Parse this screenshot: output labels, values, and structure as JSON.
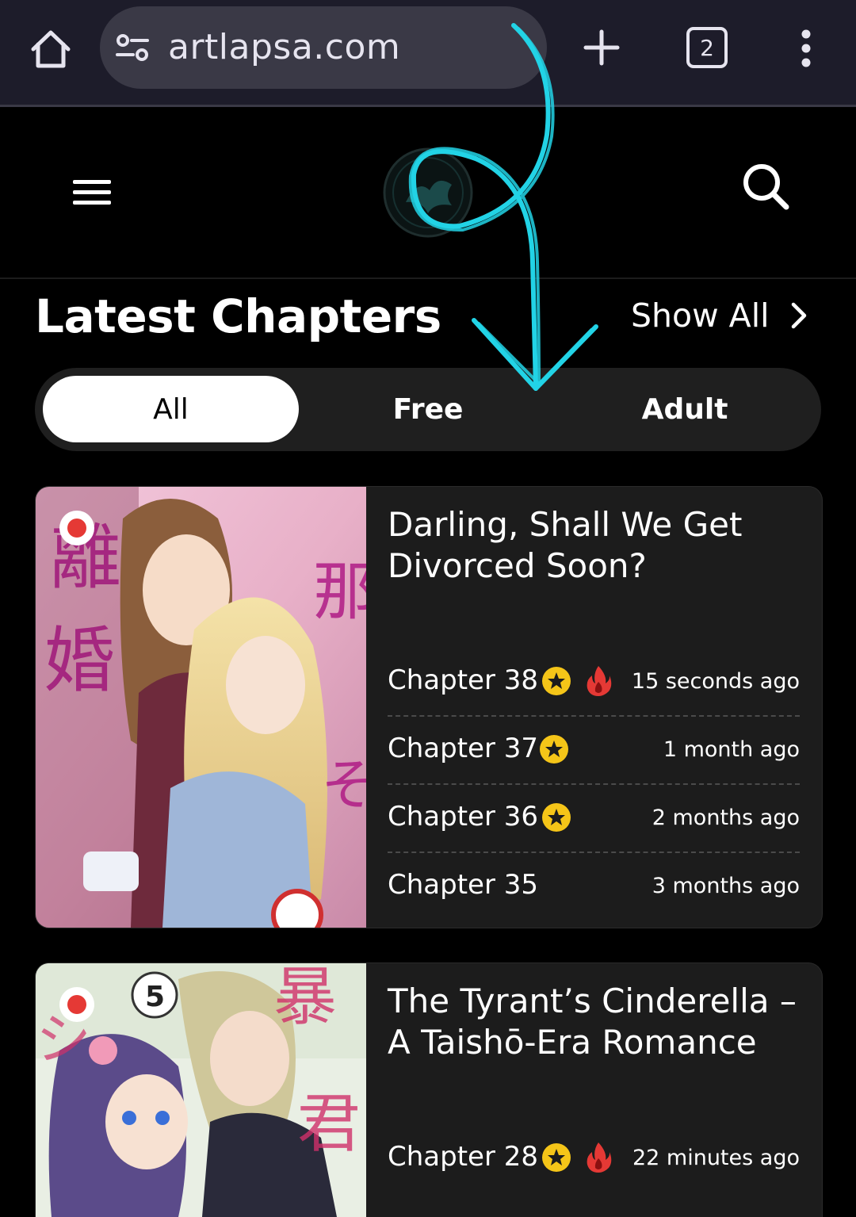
{
  "browser": {
    "url": "artlapsa.com",
    "tab_count": "2"
  },
  "icons": {
    "home": "home-icon",
    "site_info": "tune-icon",
    "new_tab": "plus-icon",
    "more": "vertical-dots-icon",
    "hamburger": "hamburger-menu-icon",
    "search": "search-icon",
    "chevron": "chevron-right-icon",
    "star": "star-badge-icon",
    "fire": "fire-icon"
  },
  "colors": {
    "browser_bar": "#1d1c2a",
    "url_pill": "#3a3946",
    "card_bg": "#1c1c1c",
    "star": "#f5c518",
    "fire": "#e53935",
    "annotation": "#22d3e6"
  },
  "section": {
    "title": "Latest Chapters",
    "show_all": "Show All"
  },
  "filters": [
    {
      "label": "All",
      "active": true
    },
    {
      "label": "Free",
      "active": false
    },
    {
      "label": "Adult",
      "active": false
    }
  ],
  "cards": [
    {
      "title": "Darling, Shall We Get Divorced Soon?",
      "chapters": [
        {
          "label": "Chapter 38",
          "time": "15 seconds ago",
          "star": true,
          "fire": true
        },
        {
          "label": "Chapter 37",
          "time": "1 month ago",
          "star": true,
          "fire": false
        },
        {
          "label": "Chapter 36",
          "time": "2 months ago",
          "star": true,
          "fire": false
        },
        {
          "label": "Chapter 35",
          "time": "3 months ago",
          "star": false,
          "fire": false
        }
      ]
    },
    {
      "title": "The Tyrant’s Cinderella – A Taishō-Era Romance",
      "chapters": [
        {
          "label": "Chapter 28",
          "time": "22 minutes ago",
          "star": true,
          "fire": true
        }
      ]
    }
  ]
}
